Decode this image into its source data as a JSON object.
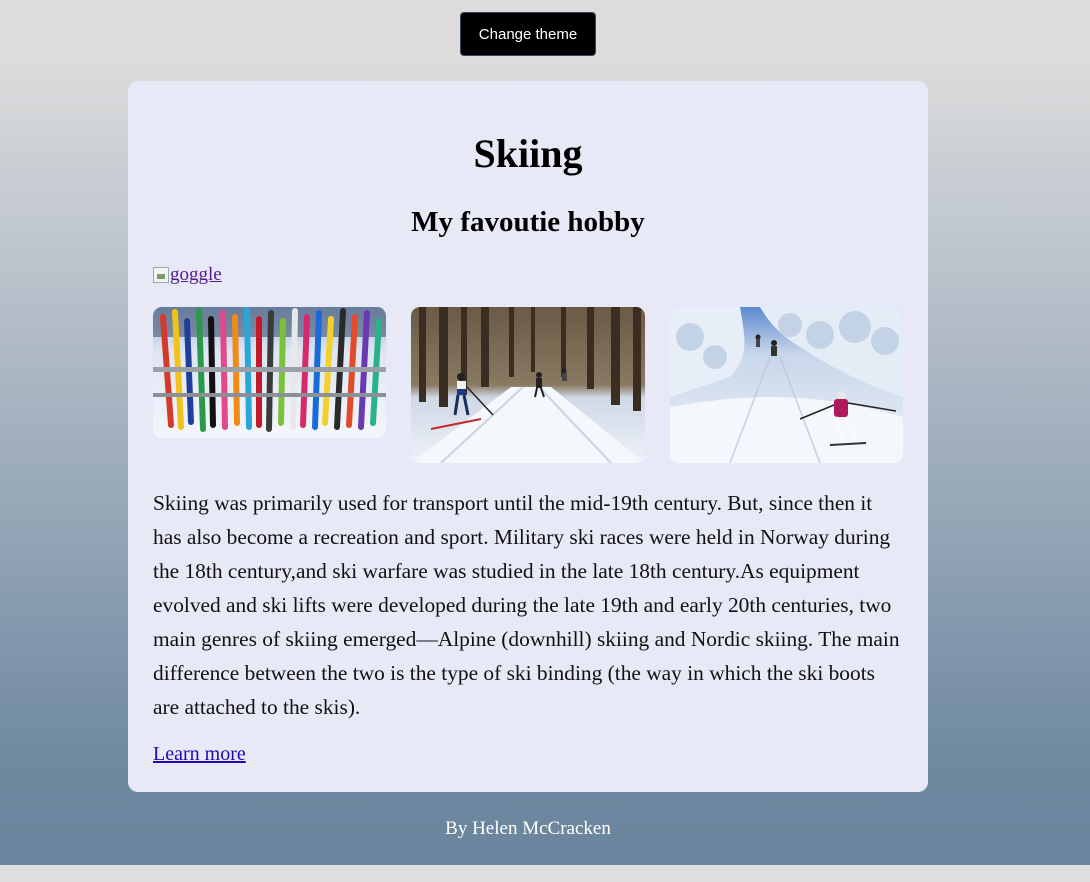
{
  "header": {
    "theme_button_label": "Change theme"
  },
  "card": {
    "title": "Skiing",
    "subtitle": "My favoutie hobby",
    "broken_image_alt": "goggle",
    "photos": [
      {
        "subject": "ski rack with many colorful skis"
      },
      {
        "subject": "cross-country skiers in a snowy forest"
      },
      {
        "subject": "skier descending a snowy slope"
      }
    ],
    "paragraph": "Skiing was primarily used for transport until the mid-19th century. But, since then it has also become a recreation and sport. Military ski races were held in Norway during the 18th century,and ski warfare was studied in the late 18th century.As equipment evolved and ski lifts were developed during the late 19th and early 20th centuries, two main genres of skiing emerged—Alpine (downhill) skiing and Nordic skiing. The main difference between the two is the type of ski binding (the way in which the ski boots are attached to the skis).",
    "learn_more_label": "Learn more"
  },
  "footer": {
    "credit": "By Helen McCracken"
  },
  "colors": {
    "card_bg": "#e7e9f6",
    "button_bg": "#000000",
    "link": "#1a0dab",
    "visited_link": "#551a8b",
    "gradient_bottom": "#6a859d"
  }
}
